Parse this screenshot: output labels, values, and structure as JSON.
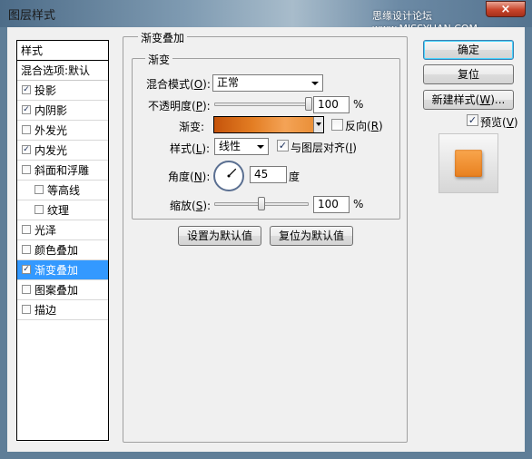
{
  "window": {
    "title": "图层样式",
    "watermark": "思缘设计论坛 www.MISSYUAN.COM",
    "close_glyph": "×"
  },
  "style_list": {
    "header": "样式",
    "blend_options": "混合选项:默认",
    "items": [
      {
        "label": "投影",
        "checked": true,
        "indent": false,
        "selected": false
      },
      {
        "label": "内阴影",
        "checked": true,
        "indent": false,
        "selected": false
      },
      {
        "label": "外发光",
        "checked": false,
        "indent": false,
        "selected": false
      },
      {
        "label": "内发光",
        "checked": true,
        "indent": false,
        "selected": false
      },
      {
        "label": "斜面和浮雕",
        "checked": false,
        "indent": false,
        "selected": false
      },
      {
        "label": "等高线",
        "checked": false,
        "indent": true,
        "selected": false
      },
      {
        "label": "纹理",
        "checked": false,
        "indent": true,
        "selected": false
      },
      {
        "label": "光泽",
        "checked": false,
        "indent": false,
        "selected": false
      },
      {
        "label": "颜色叠加",
        "checked": false,
        "indent": false,
        "selected": false
      },
      {
        "label": "渐变叠加",
        "checked": true,
        "indent": false,
        "selected": true
      },
      {
        "label": "图案叠加",
        "checked": false,
        "indent": false,
        "selected": false
      },
      {
        "label": "描边",
        "checked": false,
        "indent": false,
        "selected": false
      }
    ]
  },
  "panel": {
    "group_title": "渐变叠加",
    "subgroup_title": "渐变",
    "blend_mode": {
      "label_pre": "混合模式(",
      "key": "O",
      "label_post": "):",
      "value": "正常"
    },
    "opacity": {
      "label_pre": "不透明度(",
      "key": "P",
      "label_post": "):",
      "value": "100",
      "unit": "%",
      "level": 1.0
    },
    "gradient": {
      "label": "渐变:",
      "colors": [
        "#c5540b",
        "#e37d23",
        "#f4a356",
        "#e6892e"
      ]
    },
    "reverse": {
      "label_pre": "反向(",
      "key": "R",
      "label_post": ")",
      "checked": false
    },
    "style": {
      "label_pre": "样式(",
      "key": "L",
      "label_post": "):",
      "value": "线性"
    },
    "align": {
      "label_pre": "与图层对齐(",
      "key": "I",
      "label_post": ")",
      "checked": true
    },
    "angle": {
      "label_pre": "角度(",
      "key": "N",
      "label_post": "):",
      "value": "45",
      "unit": "度"
    },
    "scale": {
      "label_pre": "缩放(",
      "key": "S",
      "label_post": "):",
      "value": "100",
      "unit": "%",
      "level": 0.5
    },
    "set_default": "设置为默认值",
    "reset_default": "复位为默认值"
  },
  "buttons": {
    "ok": "确定",
    "reset": "复位",
    "new_style_pre": "新建样式(",
    "new_style_key": "W",
    "new_style_post": ")...",
    "preview_pre": "预览(",
    "preview_key": "V",
    "preview_post": ")",
    "preview_checked": true
  },
  "colors": {
    "selection": "#3399ff",
    "preview_swatch": "#f0901f"
  }
}
